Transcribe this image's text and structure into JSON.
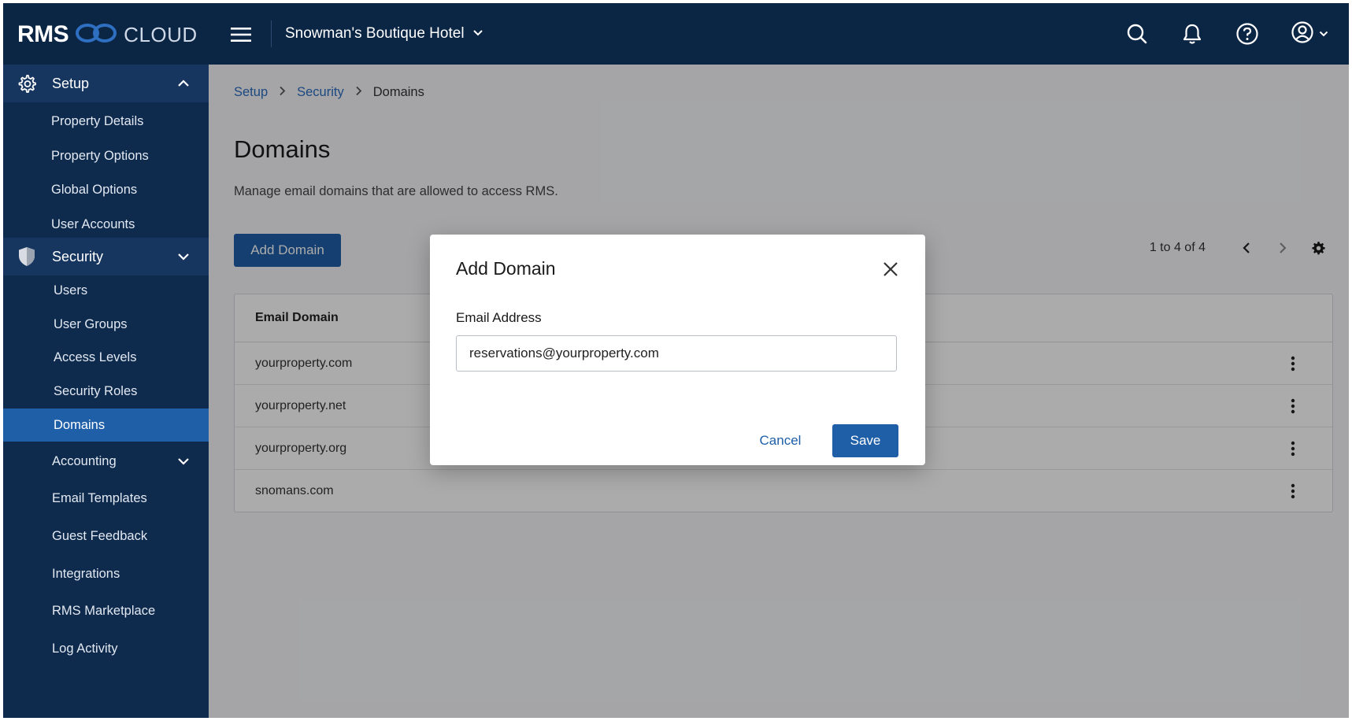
{
  "brand": {
    "rms": "RMS",
    "cloud": "CLOUD"
  },
  "header": {
    "property_name": "Snowman's Boutique Hotel",
    "icons": [
      "menu-icon",
      "search-icon",
      "bell-icon",
      "help-icon",
      "account-icon"
    ]
  },
  "sidebar": {
    "setup": {
      "label": "Setup",
      "items": [
        "Property Details",
        "Property Options",
        "Global Options",
        "User Accounts"
      ]
    },
    "security": {
      "label": "Security",
      "items": [
        "Users",
        "User Groups",
        "Access Levels",
        "Security Roles",
        "Domains"
      ],
      "active": "Domains"
    },
    "more": [
      "Accounting",
      "Email Templates",
      "Guest Feedback",
      "Integrations",
      "RMS Marketplace",
      "Log Activity"
    ]
  },
  "breadcrumb": {
    "setup": "Setup",
    "security": "Security",
    "current": "Domains"
  },
  "page": {
    "title": "Domains",
    "description": "Manage email domains that are allowed to access RMS.",
    "add_button": "Add Domain",
    "pager": "1 to 4 of 4"
  },
  "table": {
    "header": "Email Domain",
    "rows": [
      "yourproperty.com",
      "yourproperty.net",
      "yourproperty.org",
      "snomans.com"
    ]
  },
  "modal": {
    "title": "Add Domain",
    "field_label": "Email Address",
    "field_value": "reservations@yourproperty.com",
    "cancel": "Cancel",
    "save": "Save"
  },
  "colors": {
    "topbar": "#0b2545",
    "sidebar": "#0e2a4d",
    "accent": "#1f5fa8",
    "link": "#2a6cc0"
  }
}
